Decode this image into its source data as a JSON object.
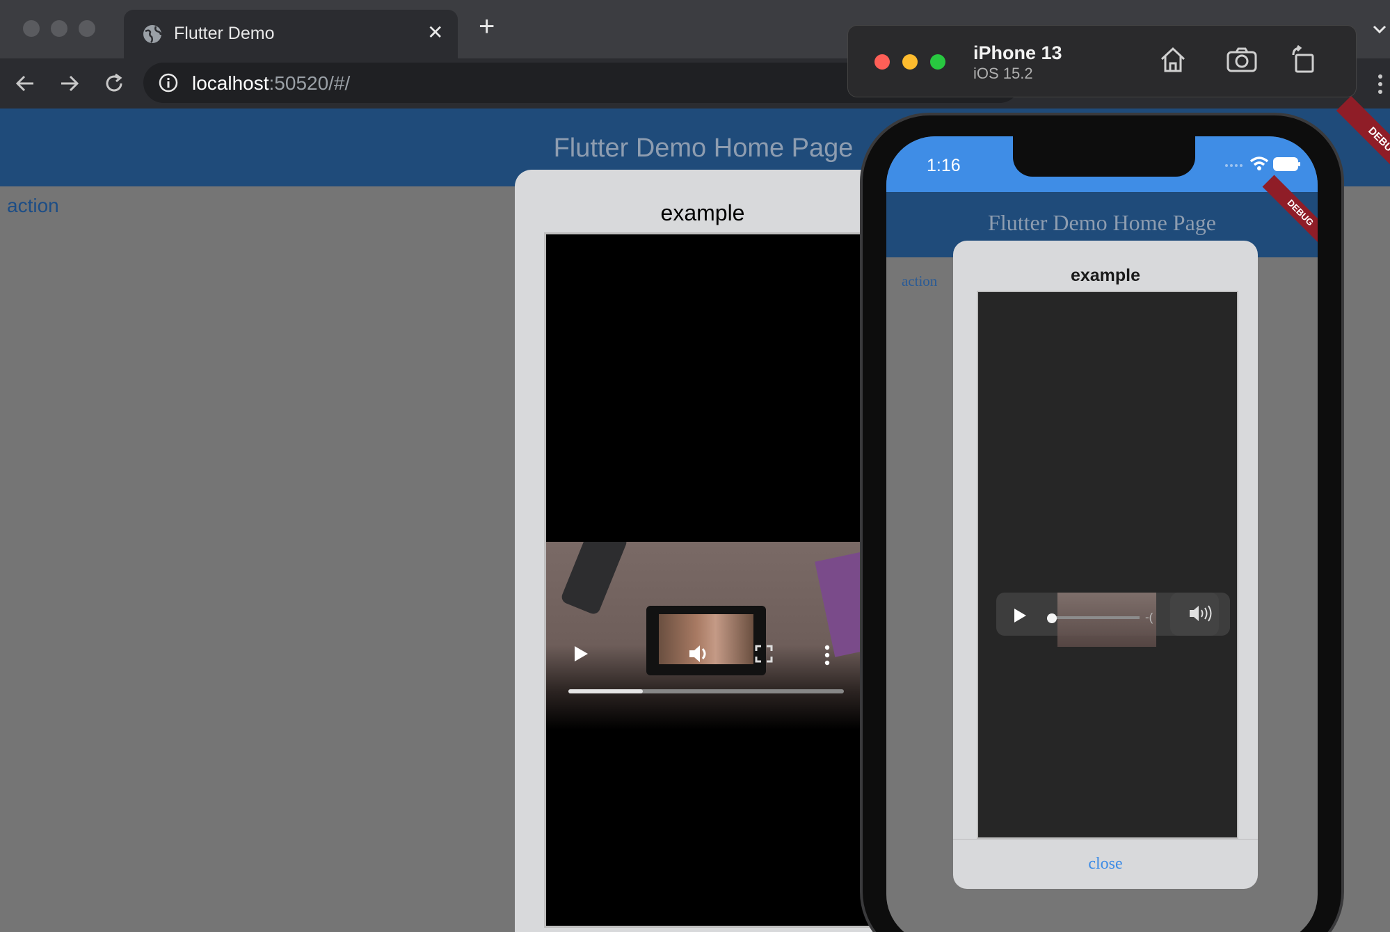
{
  "browser": {
    "tab_title": "Flutter Demo",
    "new_tab_label": "+",
    "close_tab_label": "✕",
    "url_host": "localhost",
    "url_rest": ":50520/#/"
  },
  "web_app": {
    "appbar_title": "Flutter Demo Home Page",
    "action_label": "action",
    "dialog_title": "example",
    "debug_banner": "DEBUG",
    "video_progress_fraction": 0.27
  },
  "simulator": {
    "device_name": "iPhone 13",
    "os_version": "iOS 15.2"
  },
  "phone_app": {
    "time": "1:16",
    "appbar_title": "Flutter Demo Home Page",
    "action_label": "action",
    "dialog_title": "example",
    "remaining_time": "-(",
    "close_label": "close",
    "debug_banner": "DEBUG",
    "video_progress_fraction": 0.02
  },
  "colors": {
    "appbar": "#1f4b7a",
    "page_bg": "#757575",
    "phone_status_bar": "#3f8de6",
    "close_link": "#3f8de6",
    "debug_ribbon": "#8f1d27"
  }
}
